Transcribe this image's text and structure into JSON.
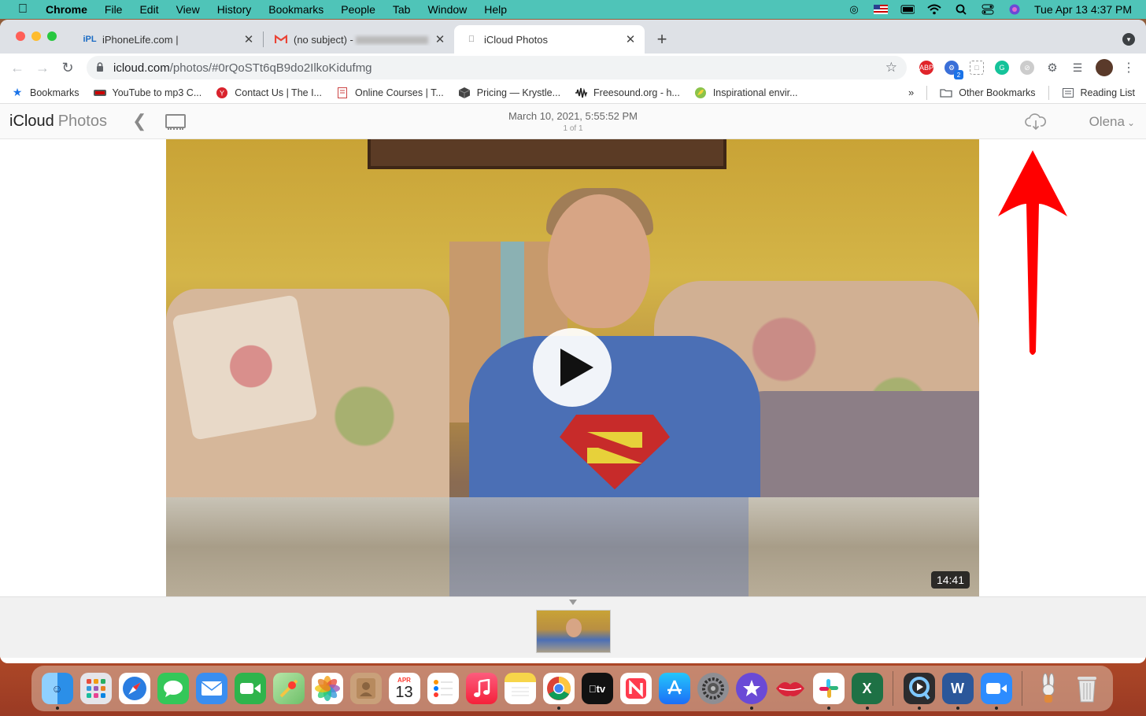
{
  "menubar": {
    "app": "Chrome",
    "items": [
      "File",
      "Edit",
      "View",
      "History",
      "Bookmarks",
      "People",
      "Tab",
      "Window",
      "Help"
    ],
    "datetime": "Tue Apr 13  4:37 PM"
  },
  "tabs": [
    {
      "title": "iPhoneLife.com |",
      "favicon": "iPL"
    },
    {
      "title": "(no subject) - ",
      "favicon": "M"
    },
    {
      "title": "iCloud Photos",
      "favicon": "apple"
    }
  ],
  "toolbar": {
    "url_host": "icloud.com",
    "url_path": "/photos/#0rQoSTt6qB9do2IlkoKidufmg",
    "extension_badge": "2"
  },
  "bookmarks": {
    "items": [
      {
        "label": "Bookmarks",
        "icon": "star-icon"
      },
      {
        "label": "YouTube to mp3 C...",
        "icon": "mp3-icon"
      },
      {
        "label": "Contact Us | The I...",
        "icon": "contact-icon"
      },
      {
        "label": "Online Courses | T...",
        "icon": "courses-icon"
      },
      {
        "label": "Pricing — Krystle...",
        "icon": "box-icon"
      },
      {
        "label": "Freesound.org - h...",
        "icon": "waveform-icon"
      },
      {
        "label": "Inspirational envir...",
        "icon": "leaf-icon"
      }
    ],
    "overflow": "»",
    "other": "Other Bookmarks",
    "reading_list": "Reading List"
  },
  "icloud": {
    "brand": "iCloud",
    "section": "Photos",
    "date": "March 10, 2021, 5:55:52 PM",
    "count": "1 of 1",
    "user": "Olena"
  },
  "video": {
    "duration": "14:41"
  },
  "calendar": {
    "month": "APR",
    "day": "13"
  },
  "dock": [
    {
      "name": "finder",
      "color": "#2b8fe8"
    },
    {
      "name": "launchpad",
      "color": "#8e8e93"
    },
    {
      "name": "safari",
      "color": "#2a7de1"
    },
    {
      "name": "messages",
      "color": "#34c759"
    },
    {
      "name": "mail",
      "color": "#3a8ef0"
    },
    {
      "name": "facetime",
      "color": "#2fb44c"
    },
    {
      "name": "maps",
      "color": "#6ec06a"
    },
    {
      "name": "photos",
      "color": "#f5f5f5"
    },
    {
      "name": "contacts",
      "color": "#c9a07a"
    },
    {
      "name": "calendar",
      "color": "#ffffff"
    },
    {
      "name": "reminders",
      "color": "#ffffff"
    },
    {
      "name": "music",
      "color": "#fa3c56"
    },
    {
      "name": "notes",
      "color": "#f7d54a"
    },
    {
      "name": "chrome",
      "color": "#ffffff"
    },
    {
      "name": "appletv",
      "color": "#111111"
    },
    {
      "name": "news",
      "color": "#ffffff"
    },
    {
      "name": "appstore",
      "color": "#1c8ef7"
    },
    {
      "name": "systemprefs",
      "color": "#8e8e93"
    },
    {
      "name": "imovie",
      "color": "#6a4ad6"
    },
    {
      "name": "kiss",
      "color": "#d9243a"
    },
    {
      "name": "slack",
      "color": "#ffffff"
    },
    {
      "name": "excel",
      "color": "#1e7145"
    }
  ],
  "dock_right": [
    {
      "name": "quicktime",
      "color": "#2c2c2e"
    },
    {
      "name": "word",
      "color": "#2b579a"
    },
    {
      "name": "zoom",
      "color": "#2d8cff"
    }
  ],
  "dock_tail": [
    {
      "name": "rabbit",
      "color": "transparent"
    },
    {
      "name": "trash",
      "color": "transparent"
    }
  ],
  "colors": {
    "menubar": "#4fc4b8",
    "arrow": "#ff0000",
    "tabbar": "#dee1e6"
  }
}
